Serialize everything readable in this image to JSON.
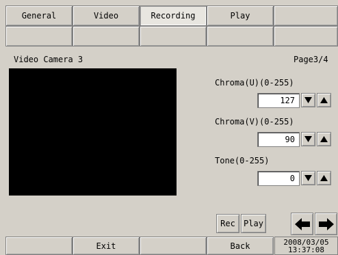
{
  "tabs": [
    {
      "label": "General"
    },
    {
      "label": "Video"
    },
    {
      "label": "Recording"
    },
    {
      "label": "Play"
    },
    {
      "label": ""
    }
  ],
  "active_tab": "Recording",
  "camera_title": "Video Camera 3",
  "page_indicator": "Page3/4",
  "settings": {
    "chroma_u": {
      "label": "Chroma(U)(0-255)",
      "value": "127"
    },
    "chroma_v": {
      "label": "Chroma(V)(0-255)",
      "value": "90"
    },
    "tone": {
      "label": "Tone(0-255)",
      "value": "0"
    }
  },
  "buttons": {
    "rec": "Rec",
    "play": "Play",
    "exit": "Exit",
    "back": "Back"
  },
  "datetime": {
    "date": "2008/03/05",
    "time": "13:37:08"
  },
  "icons": {
    "down": "triangle-down-icon",
    "up": "triangle-up-icon",
    "prev": "arrow-left-icon",
    "next": "arrow-right-icon"
  }
}
